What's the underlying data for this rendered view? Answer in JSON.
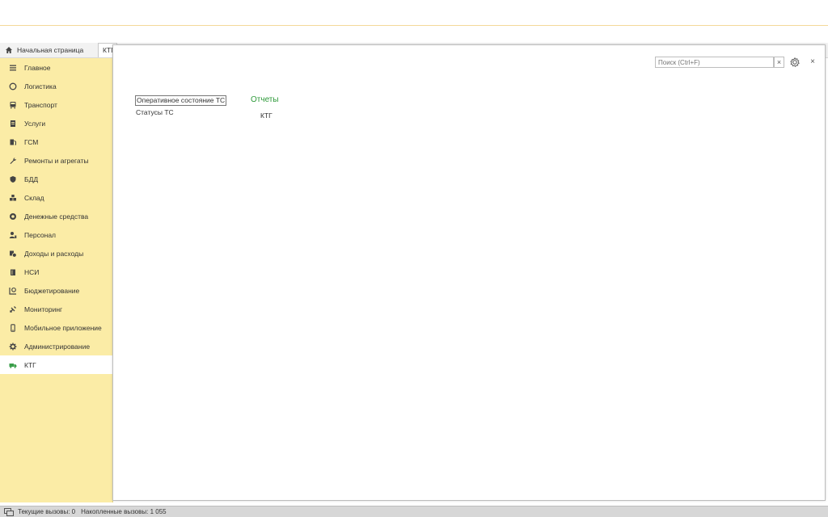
{
  "tabs": {
    "home_label": "Начальная страница",
    "current_label": "КТГ"
  },
  "sidebar": {
    "items": [
      {
        "label": "Главное",
        "icon": "menu-lines-icon"
      },
      {
        "label": "Логистика",
        "icon": "compass-icon"
      },
      {
        "label": "Транспорт",
        "icon": "bus-icon"
      },
      {
        "label": "Услуги",
        "icon": "document-icon"
      },
      {
        "label": "ГСМ",
        "icon": "fuel-icon"
      },
      {
        "label": "Ремонты и агрегаты",
        "icon": "wrench-icon"
      },
      {
        "label": "БДД",
        "icon": "shield-icon"
      },
      {
        "label": "Склад",
        "icon": "boxes-icon"
      },
      {
        "label": "Денежные средства",
        "icon": "coins-icon"
      },
      {
        "label": "Персонал",
        "icon": "person-icon"
      },
      {
        "label": "Доходы и расходы",
        "icon": "money-icon"
      },
      {
        "label": "НСИ",
        "icon": "book-icon"
      },
      {
        "label": "Бюджетирование",
        "icon": "budget-icon"
      },
      {
        "label": "Мониторинг",
        "icon": "satellite-icon"
      },
      {
        "label": "Мобильное приложение",
        "icon": "phone-icon"
      },
      {
        "label": "Администрирование",
        "icon": "gear-icon"
      },
      {
        "label": "КТГ",
        "icon": "truck-icon",
        "active": true
      }
    ]
  },
  "panel": {
    "search_placeholder": "Поиск (Ctrl+F)",
    "search_clear": "×",
    "close": "×",
    "links": [
      "Оперативное состояние ТС",
      "Статусы ТС"
    ],
    "section_title": "Отчеты",
    "section_links": [
      "КТГ"
    ]
  },
  "status": {
    "current_calls": "Текущие вызовы: 0",
    "accumulated_calls": "Накопленные вызовы: 1 055"
  },
  "colors": {
    "sidebar_bg": "#fbeca6",
    "section_title": "#2e9a3a",
    "active_item_bg": "#ffffff"
  }
}
